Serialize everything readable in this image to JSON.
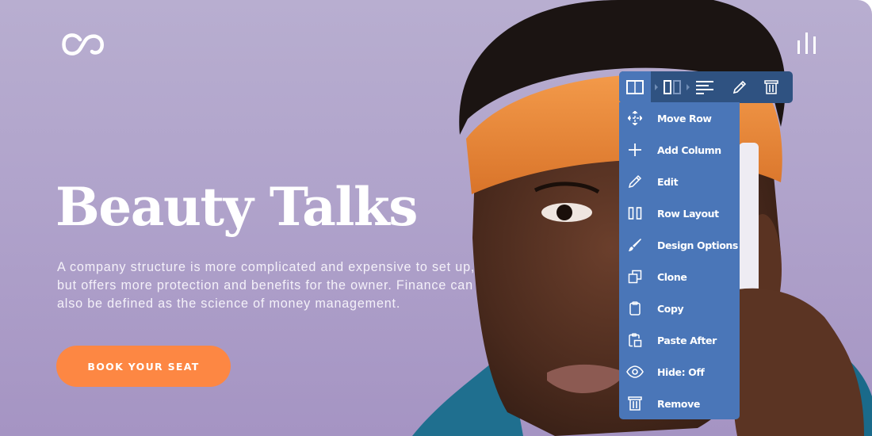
{
  "hero": {
    "title": "Beauty Talks",
    "description": "A company structure is more complicated and expensive to set up, but offers more protection and benefits for the owner. Finance can also be defined as the science of money management.",
    "cta_label": "BOOK YOUR SEAT",
    "logo_icon": "infinity-logo-icon",
    "menu_icon": "bars-menu-icon"
  },
  "colors": {
    "background": "#b3a7cd",
    "accent": "#fd8743",
    "toolbar_dark": "#2f5281",
    "toolbar_active": "#4a76b8",
    "text_light": "#ffffff"
  },
  "toolbar": {
    "buttons": [
      {
        "icon": "row-columns-icon",
        "active": true
      },
      {
        "icon": "column-icon",
        "active": false
      },
      {
        "icon": "text-align-left-icon",
        "active": false
      },
      {
        "icon": "pencil-icon",
        "active": false
      },
      {
        "icon": "trash-icon",
        "active": false
      }
    ]
  },
  "context_menu": {
    "items": [
      {
        "label": "Move Row",
        "icon": "move-icon"
      },
      {
        "label": "Add Column",
        "icon": "plus-icon"
      },
      {
        "label": "Edit",
        "icon": "pencil-icon"
      },
      {
        "label": "Row Layout",
        "icon": "row-layout-icon"
      },
      {
        "label": "Design Options",
        "icon": "brush-icon"
      },
      {
        "label": "Clone",
        "icon": "clone-icon"
      },
      {
        "label": "Copy",
        "icon": "clipboard-icon"
      },
      {
        "label": "Paste After",
        "icon": "paste-icon"
      },
      {
        "label": "Hide: Off",
        "icon": "eye-icon"
      },
      {
        "label": "Remove",
        "icon": "trash-icon"
      }
    ]
  }
}
